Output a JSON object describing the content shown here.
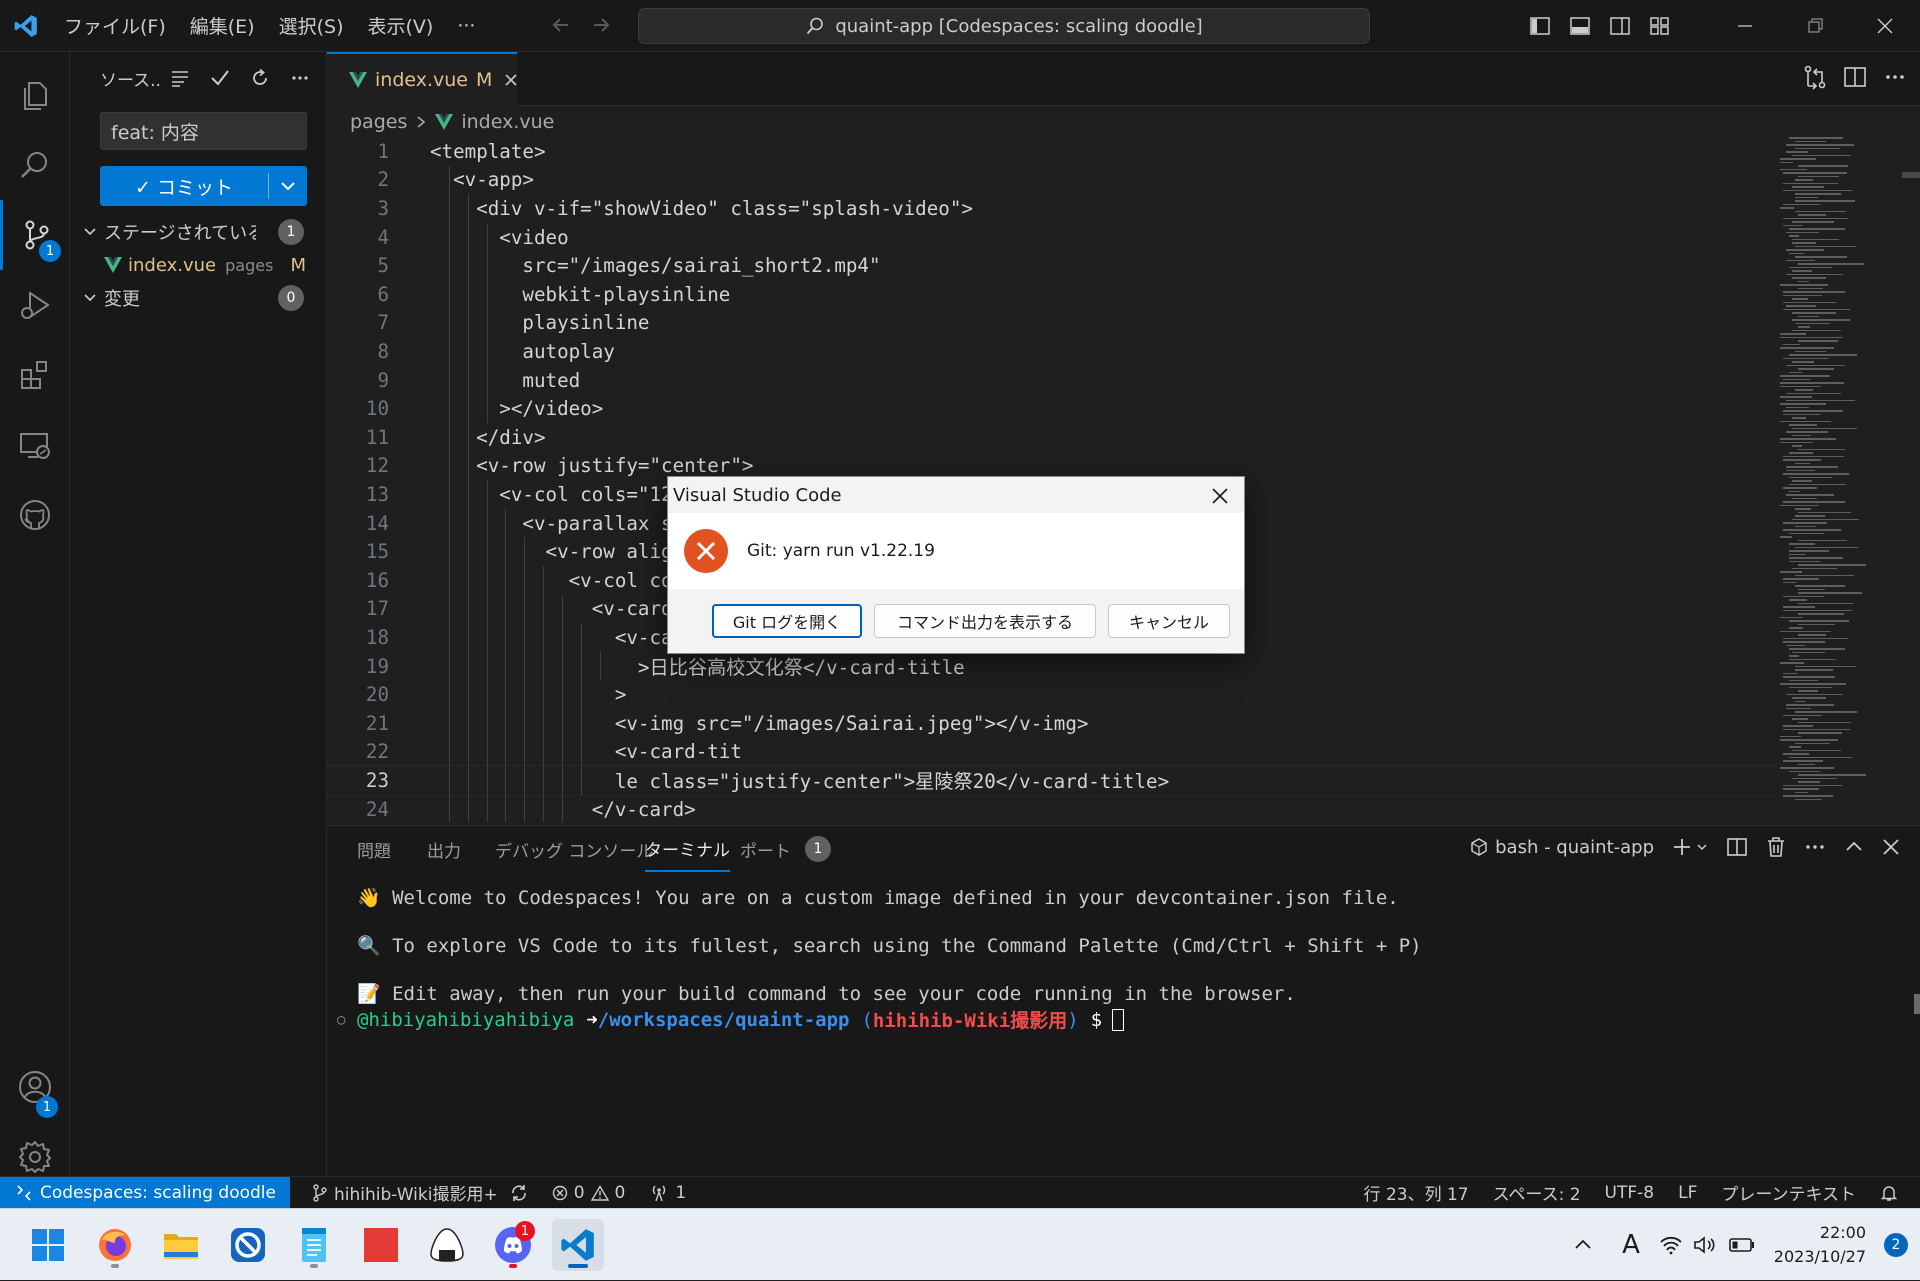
{
  "titlebar": {
    "menus": [
      "ファイル(F)",
      "編集(E)",
      "選択(S)",
      "表示(V)",
      "···"
    ],
    "command_center": "quaint-app [Codespaces: scaling doodle]"
  },
  "sidebar": {
    "title": "ソース...",
    "commit_message": "feat: 内容",
    "commit_button": "✓ コミット",
    "staged_label": "ステージされている...",
    "staged_count": "1",
    "file_name": "index.vue",
    "file_dir": "pages",
    "file_status": "M",
    "changes_label": "変更",
    "changes_count": "0",
    "scm_badge": "1",
    "accounts_badge": "1"
  },
  "editor": {
    "tab_name": "index.vue",
    "tab_status": "M",
    "breadcrumb_folder": "pages",
    "breadcrumb_file": "index.vue",
    "current_line": 23,
    "lines": [
      {
        "n": "1",
        "text": "<template>"
      },
      {
        "n": "2",
        "text": "  <v-app>"
      },
      {
        "n": "3",
        "text": "    <div v-if=\"showVideo\" class=\"splash-video\">"
      },
      {
        "n": "4",
        "text": "      <video"
      },
      {
        "n": "5",
        "text": "        src=\"/images/sairai_short2.mp4\""
      },
      {
        "n": "6",
        "text": "        webkit-playsinline"
      },
      {
        "n": "7",
        "text": "        playsinline"
      },
      {
        "n": "8",
        "text": "        autoplay"
      },
      {
        "n": "9",
        "text": "        muted"
      },
      {
        "n": "10",
        "text": "      ></video>"
      },
      {
        "n": "11",
        "text": "    </div>"
      },
      {
        "n": "12",
        "text": "    <v-row justify=\"center\">"
      },
      {
        "n": "13",
        "text": "      <v-col cols=\"12"
      },
      {
        "n": "14",
        "text": "        <v-parallax s"
      },
      {
        "n": "15",
        "text": "          <v-row alig"
      },
      {
        "n": "16",
        "text": "            <v-col co"
      },
      {
        "n": "17",
        "text": "              <v-card"
      },
      {
        "n": "18",
        "text": "                <v-ca"
      },
      {
        "n": "19",
        "text": "                  >日比谷高校文化祭</v-card-title"
      },
      {
        "n": "20",
        "text": "                >"
      },
      {
        "n": "21",
        "text": "                <v-img src=\"/images/Sairai.jpeg\"></v-img>"
      },
      {
        "n": "22",
        "text": "                <v-card-tit"
      },
      {
        "n": "23",
        "text": "                le class=\"justify-center\">星陵祭20</v-card-title>"
      },
      {
        "n": "24",
        "text": "              </v-card>"
      }
    ]
  },
  "panel": {
    "tabs": [
      "問題",
      "出力",
      "デバッグ コンソール",
      "ターミナル",
      "ポート"
    ],
    "ports_count": "1",
    "terminal_name": "bash - quaint-app",
    "terminal_lines": [
      "👋 Welcome to Codespaces! You are on a custom image defined in your devcontainer.json file.",
      "🔍 To explore VS Code to its fullest, search using the Command Palette (Cmd/Ctrl + Shift + P)",
      "📝 Edit away, then run your build command to see your code running in the browser."
    ],
    "prompt_user": "@hibiyahibiyahibiya",
    "prompt_arrow": "➜",
    "prompt_path": "/workspaces/quaint-app",
    "prompt_branch_open": "(",
    "prompt_branch": "hihihib-Wiki撮影用",
    "prompt_branch_close": ")",
    "prompt_dollar": "$"
  },
  "dialog": {
    "title": "Visual Studio Code",
    "message": "Git: yarn run v1.22.19",
    "buttons": [
      "Git ログを開く",
      "コマンド出力を表示する",
      "キャンセル"
    ]
  },
  "statusbar": {
    "remote": "Codespaces: scaling doodle",
    "branch": "hihihib-Wiki撮影用+",
    "errors": "0",
    "warnings": "0",
    "ports": "1",
    "position": "行 23、列 17",
    "spaces": "スペース: 2",
    "encoding": "UTF-8",
    "eol": "LF",
    "language": "プレーンテキスト"
  },
  "taskbar": {
    "time": "22:00",
    "date": "2023/10/27",
    "notification_count": "2",
    "discord_badge": "1",
    "ime": "A"
  },
  "colors": {
    "accent": "#0078d4",
    "vue": "#41b883",
    "modified": "#e2c08d",
    "error": "#e0521f"
  }
}
